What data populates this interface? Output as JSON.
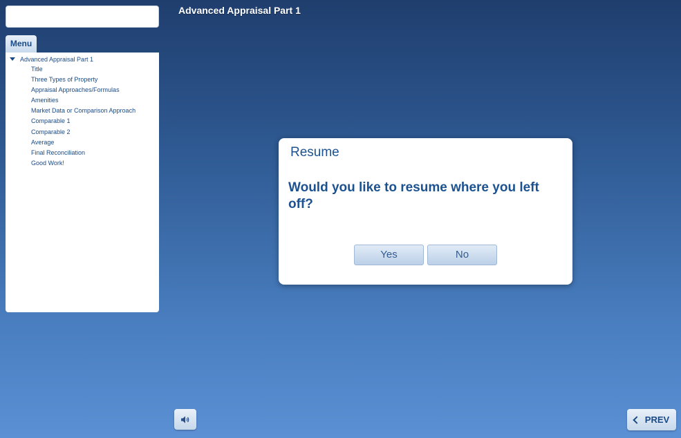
{
  "search": {
    "value": ""
  },
  "menu": {
    "tab_label": "Menu",
    "root_label": "Advanced Appraisal Part 1",
    "items": [
      {
        "label": "Title"
      },
      {
        "label": "Three Types of Property"
      },
      {
        "label": "Appraisal Approaches/Formulas"
      },
      {
        "label": "Amenities"
      },
      {
        "label": "Market Data or Comparison Approach"
      },
      {
        "label": "Comparable 1"
      },
      {
        "label": "Comparable 2"
      },
      {
        "label": "Average"
      },
      {
        "label": "Final Reconciliation"
      },
      {
        "label": "Good Work!"
      }
    ]
  },
  "header": {
    "title": "Advanced Appraisal Part 1"
  },
  "dialog": {
    "title": "Resume",
    "question": "Would you like to resume where you left off?",
    "yes_label": "Yes",
    "no_label": "No"
  },
  "footer": {
    "prev_label": "PREV",
    "audio_icon": "speaker-icon",
    "prev_icon": "chevron-left-icon"
  },
  "colors": {
    "accent": "#1a4a85",
    "background_top": "#1f3e6e",
    "background_bottom": "#5b90d4"
  }
}
